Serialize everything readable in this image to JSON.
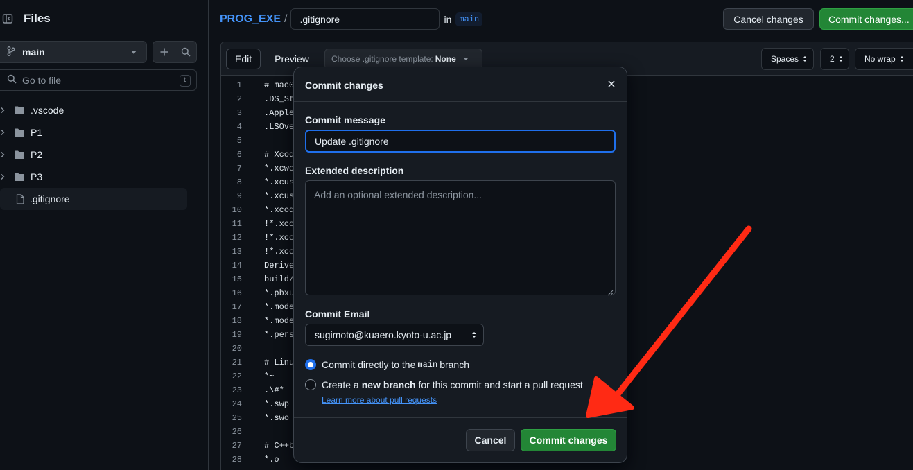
{
  "sidebar": {
    "title": "Files",
    "branch": "main",
    "goto_placeholder": "Go to file",
    "goto_shortcut": "t",
    "tree": [
      {
        "name": ".vscode",
        "type": "folder"
      },
      {
        "name": "P1",
        "type": "folder"
      },
      {
        "name": "P2",
        "type": "folder"
      },
      {
        "name": "P3",
        "type": "folder"
      },
      {
        "name": ".gitignore",
        "type": "file"
      }
    ]
  },
  "header": {
    "repo": "PROG_EXE",
    "separator": "/",
    "filename": ".gitignore",
    "in_label": "in",
    "branch": "main",
    "cancel_label": "Cancel changes",
    "commit_label": "Commit changes..."
  },
  "editor": {
    "tabs": [
      "Edit",
      "Preview"
    ],
    "template_label": "Choose .gitignore template:",
    "template_value": "None",
    "indent_mode": "Spaces",
    "indent_size": "2",
    "wrap_mode": "No wrap",
    "lines": [
      {
        "n": "1",
        "t": "# mac0"
      },
      {
        "n": "2",
        "t": ".DS_St"
      },
      {
        "n": "3",
        "t": ".Apple"
      },
      {
        "n": "4",
        "t": ".LSOve"
      },
      {
        "n": "5",
        "t": ""
      },
      {
        "n": "6",
        "t": "# Xcod"
      },
      {
        "n": "7",
        "t": "*.xcwo"
      },
      {
        "n": "8",
        "t": "*.xcus"
      },
      {
        "n": "9",
        "t": "*.xcus"
      },
      {
        "n": "10",
        "t": "*.xcod"
      },
      {
        "n": "11",
        "t": "!*.xco"
      },
      {
        "n": "12",
        "t": "!*.xco"
      },
      {
        "n": "13",
        "t": "!*.xco"
      },
      {
        "n": "14",
        "t": "Derive"
      },
      {
        "n": "15",
        "t": "build/"
      },
      {
        "n": "16",
        "t": "*.pbxu"
      },
      {
        "n": "17",
        "t": "*.mode"
      },
      {
        "n": "18",
        "t": "*.mode"
      },
      {
        "n": "19",
        "t": "*.pers"
      },
      {
        "n": "20",
        "t": ""
      },
      {
        "n": "21",
        "t": "# Linu"
      },
      {
        "n": "22",
        "t": "*~"
      },
      {
        "n": "23",
        "t": ".\\#*"
      },
      {
        "n": "24",
        "t": "*.swp"
      },
      {
        "n": "25",
        "t": "*.swo"
      },
      {
        "n": "26",
        "t": ""
      },
      {
        "n": "27",
        "t": "# C++b"
      },
      {
        "n": "28",
        "t": "*.o"
      }
    ]
  },
  "dialog": {
    "title": "Commit changes",
    "message_label": "Commit message",
    "message_value": "Update .gitignore",
    "description_label": "Extended description",
    "description_placeholder": "Add an optional extended description...",
    "email_label": "Commit Email",
    "email_value": "sugimoto@kuaero.kyoto-u.ac.jp",
    "option1_prefix": "Commit directly to the",
    "option1_branch": "main",
    "option1_suffix": "branch",
    "option2_prefix": "Create a",
    "option2_bold": "new branch",
    "option2_suffix": "for this commit and start a pull request",
    "learn_more": "Learn more about pull requests",
    "cancel_label": "Cancel",
    "commit_label": "Commit changes"
  },
  "colors": {
    "background": "#0d1117",
    "panel": "#161b22",
    "accent_blue": "#4493f8",
    "primary_green": "#238636",
    "annotation_red": "#ff2a14"
  }
}
